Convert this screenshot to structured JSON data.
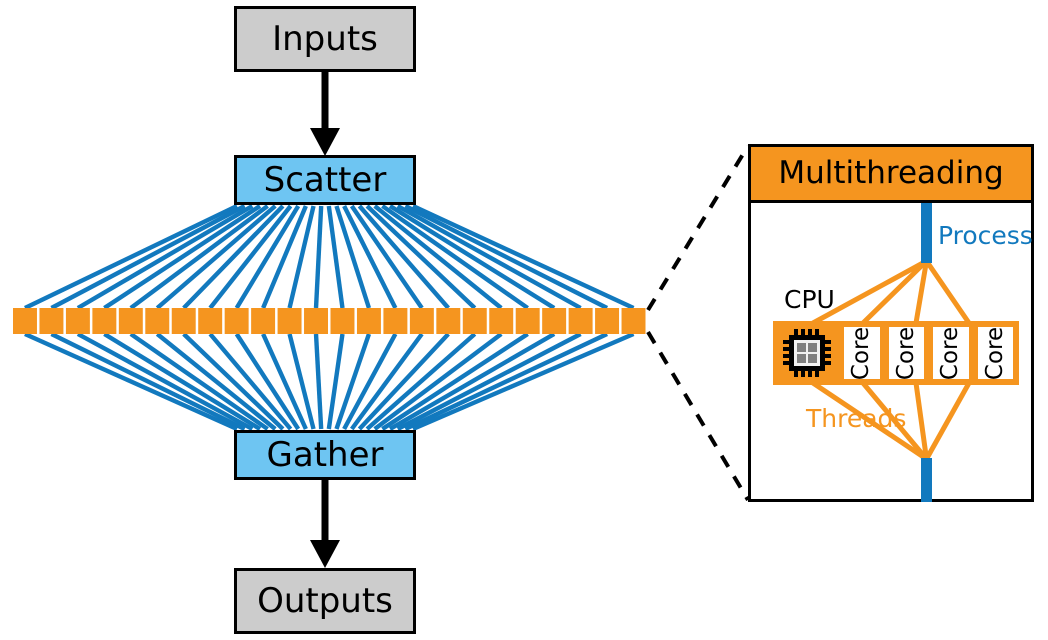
{
  "diagram": {
    "title": "Scatter-Gather parallel execution with multithreading detail",
    "colors": {
      "gray_box": "#cccccc",
      "blue_box": "#6ec5f2",
      "blue_line": "#1279be",
      "orange": "#f5951f",
      "black": "#000000",
      "white": "#ffffff"
    }
  },
  "flow": {
    "inputs_label": "Inputs",
    "scatter_label": "Scatter",
    "gather_label": "Gather",
    "outputs_label": "Outputs",
    "worker_count": 24,
    "fan_line_count": 24
  },
  "panel": {
    "title": "Multithreading",
    "process_label": "Process",
    "threads_label": "Threads",
    "cpu_label": "CPU",
    "cpu_icon": "cpu-chip-icon",
    "cores": [
      {
        "label": "Core"
      },
      {
        "label": "Core"
      },
      {
        "label": "Core"
      },
      {
        "label": "Core"
      }
    ]
  }
}
